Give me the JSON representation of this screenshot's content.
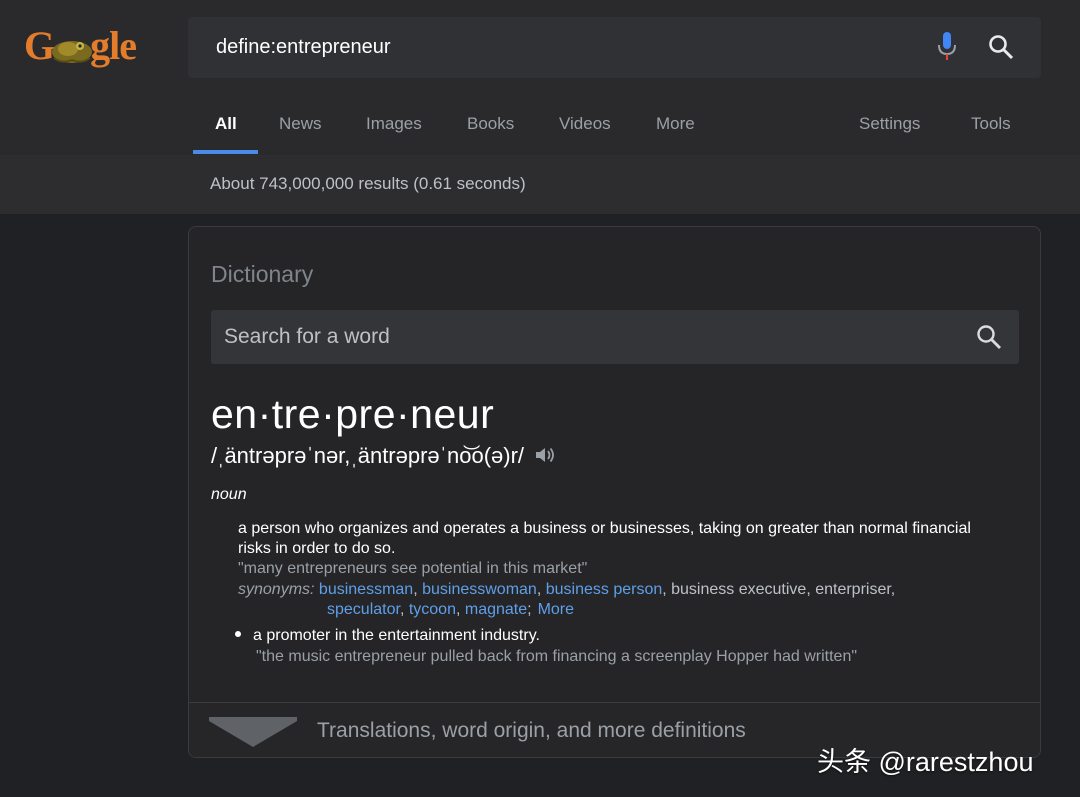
{
  "logo": {
    "text_left": "G",
    "text_right": "gle"
  },
  "search": {
    "query": "define:entrepreneur"
  },
  "tabs": [
    {
      "label": "All"
    },
    {
      "label": "News"
    },
    {
      "label": "Images"
    },
    {
      "label": "Books"
    },
    {
      "label": "Videos"
    },
    {
      "label": "More"
    },
    {
      "label": "Settings"
    },
    {
      "label": "Tools"
    }
  ],
  "results": {
    "stats": "About 743,000,000 results (0.61 seconds)"
  },
  "dictionary": {
    "title": "Dictionary",
    "search_placeholder": "Search for a word",
    "headword": "en·tre·pre·neur",
    "phonetic": "/ˌäntrəprəˈnər,ˌäntrəprəˈno͝o(ə)r/",
    "part_of_speech": "noun",
    "definition_1": "a person who organizes and operates a business or businesses, taking on greater than normal financial risks in order to do so.",
    "example_1": "\"many entrepreneurs see potential in this market\"",
    "synonyms_label": "synonyms:",
    "synonyms_line1": [
      {
        "text": "businessman",
        "link": true
      },
      {
        "text": "businesswoman",
        "link": true
      },
      {
        "text": "business person",
        "link": true
      },
      {
        "text": "business executive",
        "link": false
      },
      {
        "text": "enterpriser",
        "link": false
      }
    ],
    "synonyms_line2": [
      {
        "text": "speculator",
        "link": true
      },
      {
        "text": "tycoon",
        "link": true
      },
      {
        "text": "magnate",
        "link": true
      }
    ],
    "more_label": "More",
    "definition_2": "a promoter in the entertainment industry.",
    "example_2": "\"the music entrepreneur pulled back from financing a screenplay Hopper had written\"",
    "expander_label": "Translations, word origin, and more definitions"
  },
  "watermark": "头条 @rarestzhou",
  "colors": {
    "background": "#202124",
    "header": "#2a2a2c",
    "link": "#5e9fe8",
    "tab_underline": "#4a8ae8",
    "logo": "#e37d2c"
  }
}
